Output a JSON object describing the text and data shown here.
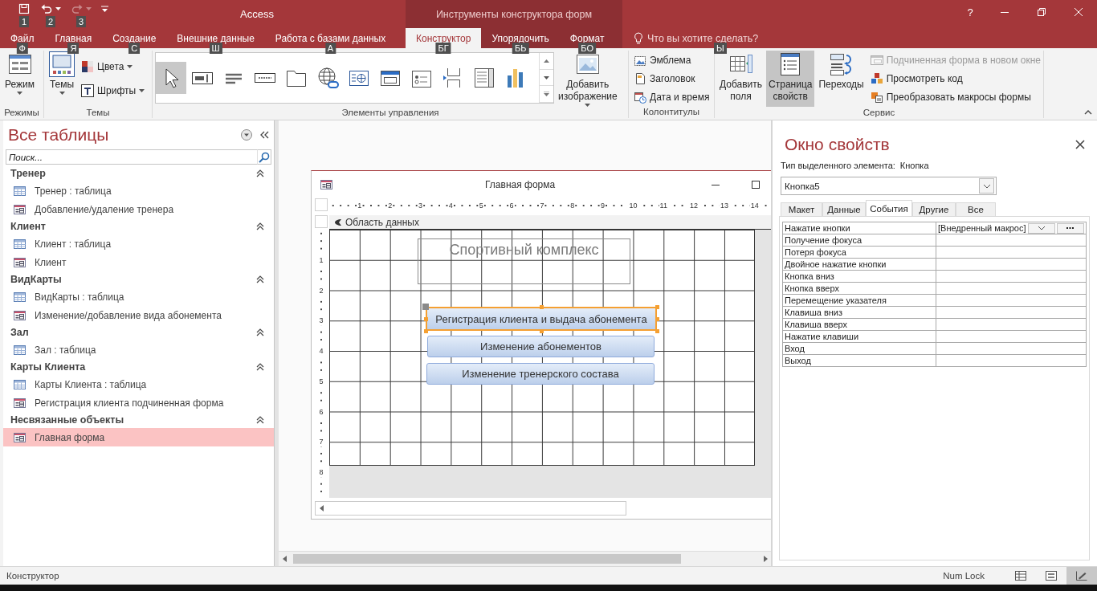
{
  "title_bar": {
    "quick_access": [
      {
        "keytip": "1",
        "disabled": false
      },
      {
        "keytip": "2",
        "disabled": false
      },
      {
        "keytip": "3",
        "disabled": true
      }
    ],
    "app_title": "Access",
    "context_title": "Инструменты конструктора форм",
    "help": "?"
  },
  "ribbon_tabs": [
    {
      "label": "Файл",
      "keytip": "Ф",
      "selected": false,
      "contextual": false
    },
    {
      "label": "Главная",
      "keytip": "Я",
      "selected": false,
      "contextual": false
    },
    {
      "label": "Создание",
      "keytip": "С",
      "selected": false,
      "contextual": false
    },
    {
      "label": "Внешние данные",
      "keytip": "Ш",
      "selected": false,
      "contextual": false
    },
    {
      "label": "Работа с базами данных",
      "keytip": "А",
      "selected": false,
      "contextual": false
    },
    {
      "label": "Конструктор",
      "keytip": "БГ",
      "selected": true,
      "contextual": true
    },
    {
      "label": "Упорядочить",
      "keytip": "БЬ",
      "selected": false,
      "contextual": true
    },
    {
      "label": "Формат",
      "keytip": "БО",
      "selected": false,
      "contextual": true
    }
  ],
  "tell_me": {
    "placeholder": "Что вы хотите сделать?",
    "keytip": "Ы"
  },
  "ribbon_groups": [
    {
      "label": "Режимы",
      "controls": [
        {
          "kind": "large",
          "label": "Режим",
          "dropdown": true,
          "pressed": false
        }
      ]
    },
    {
      "label": "Темы",
      "controls": [
        {
          "kind": "large",
          "label": "Темы",
          "dropdown": true,
          "pressed": false
        },
        {
          "kind": "stack",
          "items": [
            {
              "label": "Цвета",
              "dropdown": true,
              "disabled": false
            },
            {
              "label": "Шрифты",
              "dropdown": true,
              "disabled": false
            }
          ]
        }
      ]
    },
    {
      "label": "Элементы управления",
      "controls": [
        {
          "kind": "gallery",
          "tools": [
            {
              "selected": true
            },
            {
              "selected": false
            },
            {
              "selected": false
            },
            {
              "selected": false
            },
            {
              "selected": false
            },
            {
              "selected": false
            },
            {
              "selected": false
            },
            {
              "selected": false
            },
            {
              "selected": false
            },
            {
              "selected": false
            },
            {
              "selected": false
            },
            {
              "selected": false
            }
          ]
        },
        {
          "kind": "large",
          "label": "Добавить изображение",
          "dropdown": true,
          "pressed": false
        }
      ]
    },
    {
      "label": "Колонтитулы",
      "controls": [
        {
          "kind": "stack",
          "items": [
            {
              "label": "Эмблема",
              "dropdown": false,
              "disabled": false
            },
            {
              "label": "Заголовок",
              "dropdown": false,
              "disabled": false
            },
            {
              "label": "Дата и время",
              "dropdown": false,
              "disabled": false
            }
          ]
        }
      ]
    },
    {
      "label": "Сервис",
      "controls": [
        {
          "kind": "large",
          "label": "Добавить поля",
          "dropdown": false,
          "pressed": false
        },
        {
          "kind": "large",
          "label": "Страница свойств",
          "dropdown": false,
          "pressed": true
        },
        {
          "kind": "large",
          "label": "Переходы",
          "dropdown": false,
          "pressed": false
        },
        {
          "kind": "stack",
          "items": [
            {
              "label": "Подчиненная форма в новом окне",
              "dropdown": false,
              "disabled": true
            },
            {
              "label": "Просмотреть код",
              "dropdown": false,
              "disabled": false
            },
            {
              "label": "Преобразовать макросы формы",
              "dropdown": false,
              "disabled": false
            }
          ]
        }
      ]
    }
  ],
  "nav_pane": {
    "title": "Все таблицы",
    "search": {
      "placeholder": "Поиск..."
    },
    "groups": [
      {
        "heading": "Тренер",
        "expanded": true,
        "items": [
          {
            "label": "Тренер : таблица",
            "kind": "table",
            "selected": false
          },
          {
            "label": "Добавление/удаление тренера",
            "kind": "form",
            "selected": false
          }
        ]
      },
      {
        "heading": "Клиент",
        "expanded": true,
        "items": [
          {
            "label": "Клиент : таблица",
            "kind": "table",
            "selected": false
          },
          {
            "label": "Клиент",
            "kind": "form",
            "selected": false
          }
        ]
      },
      {
        "heading": "ВидКарты",
        "expanded": true,
        "items": [
          {
            "label": "ВидКарты : таблица",
            "kind": "table",
            "selected": false
          },
          {
            "label": "Изменение/добавление вида абонемента",
            "kind": "form",
            "selected": false
          }
        ]
      },
      {
        "heading": "Зал",
        "expanded": true,
        "items": [
          {
            "label": "Зал : таблица",
            "kind": "table",
            "selected": false
          }
        ]
      },
      {
        "heading": "Карты Клиента",
        "expanded": true,
        "items": [
          {
            "label": "Карты Клиента : таблица",
            "kind": "table",
            "selected": false
          },
          {
            "label": "Регистрация клиента подчиненная форма",
            "kind": "form",
            "selected": false
          }
        ]
      },
      {
        "heading": "Несвязанные объекты",
        "expanded": true,
        "items": [
          {
            "label": "Главная форма",
            "kind": "form",
            "selected": true
          }
        ]
      }
    ]
  },
  "form_window": {
    "title": "Главная форма",
    "ruler_h": [
      "1",
      "2",
      "3",
      "4",
      "5",
      "6",
      "7",
      "8",
      "9",
      "10",
      "11",
      "12",
      "13",
      "14"
    ],
    "ruler_v": [
      "1",
      "2",
      "3",
      "4",
      "5",
      "6",
      "7",
      "8"
    ],
    "section": "Область данных",
    "label": "Спортивный комплекс",
    "buttons": [
      {
        "label": "Регистрация клиента и выдача абонемента",
        "selected": true
      },
      {
        "label": "Изменение абонементов",
        "selected": false
      },
      {
        "label": "Изменение тренерского состава",
        "selected": false
      }
    ]
  },
  "property_sheet": {
    "title": "Окно свойств",
    "selection_type_label": "Тип выделенного элемента:",
    "selection_type": "Кнопка",
    "object": "Кнопка5",
    "tabs": [
      {
        "label": "Макет",
        "selected": false
      },
      {
        "label": "Данные",
        "selected": false
      },
      {
        "label": "События",
        "selected": true
      },
      {
        "label": "Другие",
        "selected": false
      },
      {
        "label": "Все",
        "selected": false
      }
    ],
    "properties": [
      {
        "name": "Нажатие кнопки",
        "value": "[Внедренный макрос]",
        "selected": true
      },
      {
        "name": "Получение фокуса",
        "selected": false
      },
      {
        "name": "Потеря фокуса",
        "selected": false
      },
      {
        "name": "Двойное нажатие кнопки",
        "selected": false
      },
      {
        "name": "Кнопка вниз",
        "selected": false
      },
      {
        "name": "Кнопка вверх",
        "selected": false
      },
      {
        "name": "Перемещение указателя",
        "selected": false
      },
      {
        "name": "Клавиша вниз",
        "selected": false
      },
      {
        "name": "Клавиша вверх",
        "selected": false
      },
      {
        "name": "Нажатие клавиши",
        "selected": false
      },
      {
        "name": "Вход",
        "selected": false
      },
      {
        "name": "Выход",
        "selected": false
      }
    ]
  },
  "status_bar": {
    "text": "Конструктор",
    "num_lock": "Num Lock",
    "views": [
      {
        "selected": false
      },
      {
        "selected": false
      },
      {
        "selected": true
      }
    ]
  }
}
